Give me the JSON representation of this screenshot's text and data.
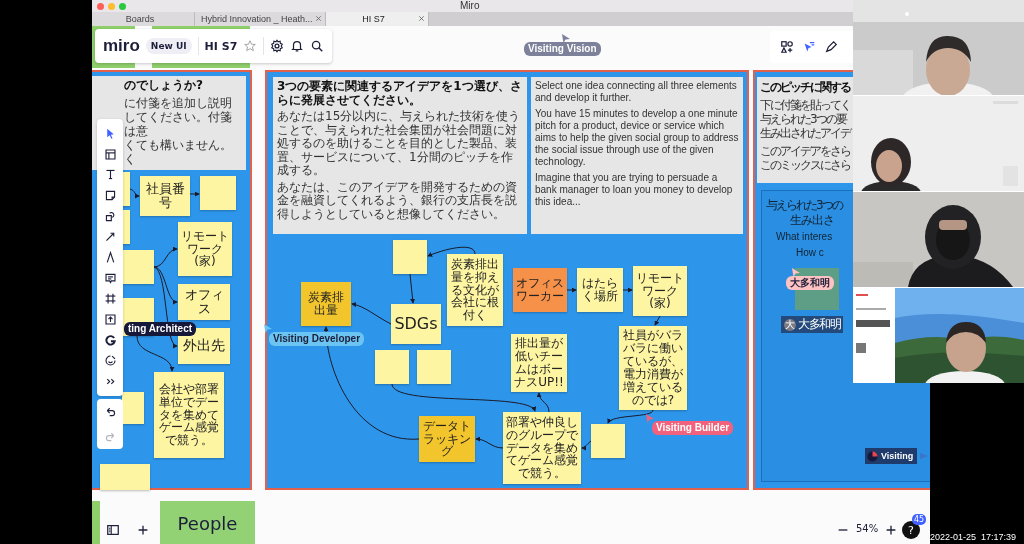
{
  "window": {
    "title": "Miro",
    "tabs": [
      {
        "label": "Boards",
        "selected": false,
        "closable": false
      },
      {
        "label": "Hybrid Innovation _ Heath...",
        "selected": false,
        "closable": true
      },
      {
        "label": "HI S7",
        "selected": true,
        "closable": true
      }
    ]
  },
  "board_toolbar": {
    "logo": "miro",
    "badge": "New UI",
    "board_name": "HI S7"
  },
  "frames": [
    {
      "kind": "left",
      "header": [
        {
          "bold": true,
          "lines": [
            "のでしょうか?"
          ]
        },
        {
          "bold": false,
          "lines": [
            "に付箋を追加し説明してください。付箋は意",
            "くても構いません。",
            "く"
          ]
        }
      ],
      "stickies": [
        {
          "color": "#fdf5a2"
        },
        {
          "text": "社員番号",
          "color": "#fdf5a2"
        },
        {
          "color": "#fdf5a2"
        },
        {
          "color": "#fdf5a2"
        },
        {
          "text": "リモートワーク(家)",
          "color": "#fdf5a2"
        },
        {
          "color": "#fdf5a2"
        },
        {
          "text": "オフィス",
          "color": "#fdf5a2"
        },
        {
          "text": "外出先",
          "color": "#fdf5a2"
        },
        {
          "color": "#fdf5a2"
        },
        {
          "text": "会社や部署単位でデータを集めてゲーム感覚で競う。",
          "color": "#fdf5a2"
        },
        {
          "color": "#fdf5a2"
        },
        {
          "color": "#fdf5a2"
        }
      ]
    },
    {
      "kind": "middle",
      "header": [
        {
          "bold": true,
          "lines": [
            "3つの要素に関連するアイデアを1つ選び、さらに発展させてください。"
          ]
        },
        {
          "bold": false,
          "lines": [
            "あなたは15分以内に、与えられた技術を使うことで、与えられた社会集団が社会問題に対処するのを助けることを目的とした製品、装置、サービスについて、1分間のピッチを作成する。"
          ]
        },
        {
          "bold": false,
          "lines": [
            "あなたは、このアイデアを開発するための資金を融資してくれるよう、銀行の支店長を説得しようとしていると想像してください。"
          ]
        }
      ],
      "header_en": [
        {
          "bold": false,
          "lines": [
            "Select one idea connecting all three elements and develop it further."
          ]
        },
        {
          "bold": false,
          "lines": [
            "You have 15 minutes to develop a one minute pitch for a product, device or service which aims to help the given social group to address the social issue through use of the given technology."
          ]
        },
        {
          "bold": false,
          "lines": [
            "Imagine that you are trying to persuade a bank manager to loan you money to develop this idea..."
          ]
        }
      ],
      "stickies": [
        {
          "color": "#fdf5a2"
        },
        {
          "text": "炭素排出量",
          "color": "#f2c52c"
        },
        {
          "text": "SDGs",
          "color": "#fdf5a2"
        },
        {
          "text": "炭素排出量を抑える文化が会社に根付く",
          "color": "#fdf5a2"
        },
        {
          "text": "オフィスワーカー",
          "color": "#f59149"
        },
        {
          "text": "はたらく場所",
          "color": "#fdf5a2"
        },
        {
          "text": "リモートワーク(家)",
          "color": "#fdf5a2"
        },
        {
          "color": "#fdf5a2"
        },
        {
          "color": "#fdf5a2"
        },
        {
          "text": "排出量が低いチームはボーナスUP!!",
          "color": "#fdf5a2"
        },
        {
          "text": "社員がバラバラに働いているが、電力消費が増えているのでは?",
          "color": "#fdf5a2"
        },
        {
          "text": "データトラッキング",
          "color": "#f2c52c"
        },
        {
          "text": "部署や仲良しのグループでデータを集めてゲーム感覚で競う。",
          "color": "#fdf5a2"
        },
        {
          "color": "#fdf5a2"
        }
      ]
    },
    {
      "kind": "right",
      "header": [
        {
          "bold": true,
          "lines": [
            "このピッチに関する"
          ]
        },
        {
          "bold": false,
          "lines": [
            "下に付箋を貼ってく",
            "与えられた3つの要",
            "生み出されたアイデ"
          ]
        },
        {
          "bold": false,
          "lines": [
            "このアイデアをさら",
            "このミックスにさら"
          ]
        }
      ],
      "inner_lines": [
        "与えられた3つの",
        "生み出さ",
        "What interes",
        "How c"
      ],
      "user_chip": {
        "initial": "大",
        "name": "大多和明"
      },
      "visiting": "Visiting"
    }
  ],
  "cursors": [
    {
      "name": "Visiting Vision",
      "color": "#7d8199"
    },
    {
      "name": "ting Architect",
      "color": "#16183a"
    },
    {
      "name": "Visiting Developer",
      "color": "#6cc4f2"
    },
    {
      "name": "Visiting Builder",
      "color": "#f2627c"
    },
    {
      "name": "大多和明",
      "color": "#ffc2c2"
    }
  ],
  "bottom": {
    "sticky": "People",
    "zoom": "54%",
    "help": "?",
    "help_badge": "45"
  },
  "timestamp": "2022-01-25  17:17:39"
}
